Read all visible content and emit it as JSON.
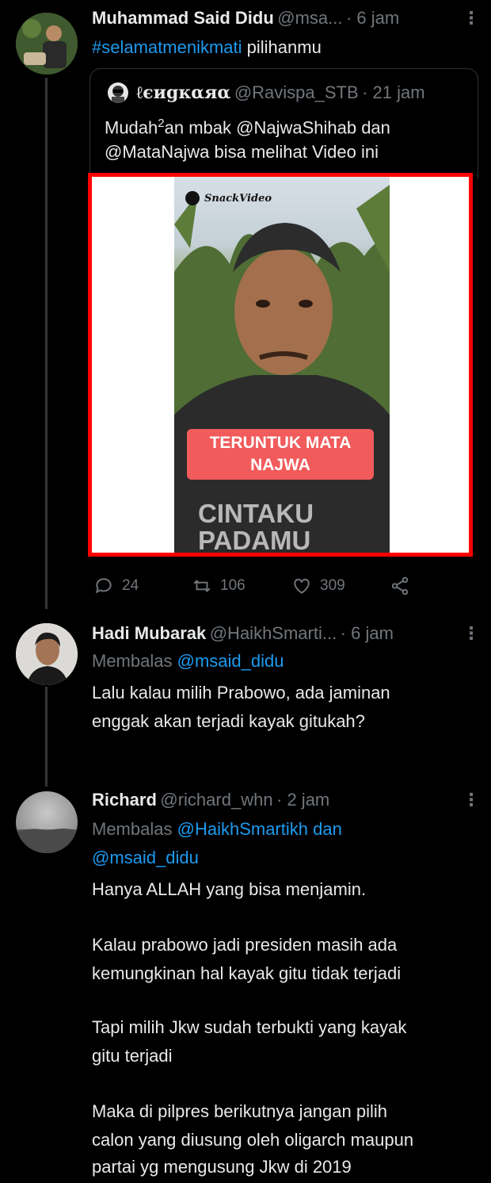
{
  "tweets": {
    "main": {
      "name": "Muhammad Said Didu",
      "handle": "@msa...",
      "time": "· 6 jam",
      "hashtag": "#selamatmenikmati",
      "text_rest": "pilihanmu",
      "quote": {
        "name": "ℓєиgкαяα",
        "handle": "@Ravispa_STB",
        "time": "· 21 jam",
        "line1_pre": "Mudah",
        "line1_sup": "2",
        "line1_post": "an mbak @NajwaShihab dan",
        "line2": "@MataNajwa bisa melihat Video ini",
        "video": {
          "watermark": "SnackVideo",
          "caption_line1": "TERUNTUK MATA",
          "caption_line2": "NAJWA",
          "shirt_line1": "CINTAKU",
          "shirt_line2": "PADAMU"
        }
      },
      "actions": {
        "replies": "24",
        "retweets": "106",
        "likes": "309"
      }
    },
    "reply1": {
      "name": "Hadi Mubarak",
      "handle": "@HaikhSmarti...",
      "time": "· 6 jam",
      "replying_label": "Membalas",
      "replying_to": "@msaid_didu",
      "line1": "Lalu kalau milih Prabowo, ada jaminan",
      "line2": "enggak akan terjadi kayak gitukah?"
    },
    "reply2": {
      "name": "Richard",
      "handle": "@richard_whn",
      "time": "· 2 jam",
      "replying_label": "Membalas",
      "replying_to_line1": "@HaikhSmartikh dan",
      "replying_to_line2": "@msaid_didu",
      "p1": "Hanya ALLAH yang bisa menjamin.",
      "p2_line1": "Kalau prabowo jadi presiden masih ada",
      "p2_line2": "kemungkinan hal kayak gitu tidak terjadi",
      "p3_line1": "Tapi milih Jkw sudah terbukti yang kayak",
      "p3_line2": "gitu terjadi",
      "p4_line1": "Maka di pilpres berikutnya jangan pilih",
      "p4_line2": "calon yang diusung oleh oligarch maupun",
      "p4_line3": "partai yg mengusung Jkw di 2019"
    }
  },
  "colors": {
    "background": "#000000",
    "link": "#1d9bf0",
    "muted": "#71767b",
    "highlight_border": "#ff0000"
  }
}
